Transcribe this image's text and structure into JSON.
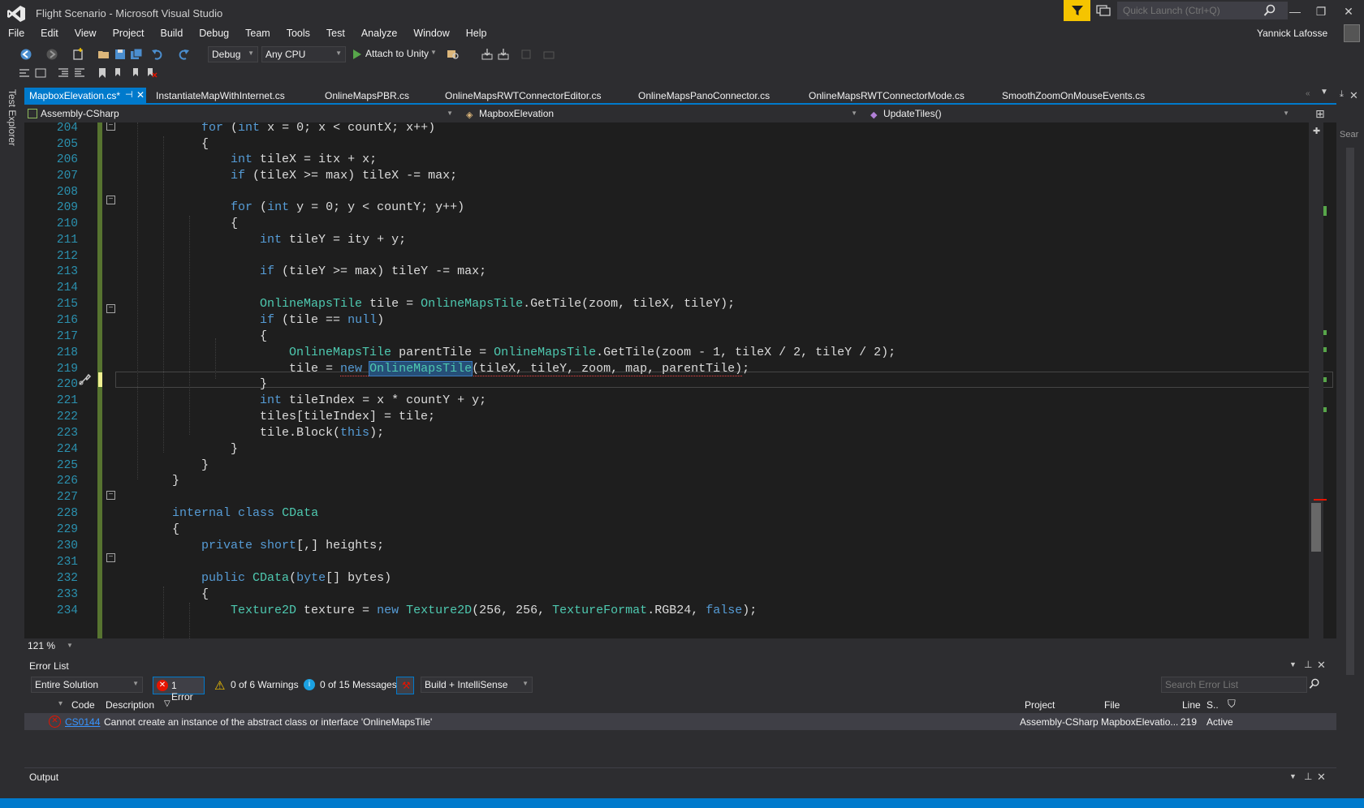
{
  "window": {
    "title": "Flight Scenario - Microsoft Visual Studio",
    "quick_launch_placeholder": "Quick Launch (Ctrl+Q)",
    "user": "Yannick Lafosse",
    "minimize": "—",
    "maximize": "❐",
    "close": "✕"
  },
  "menu": [
    "File",
    "Edit",
    "View",
    "Project",
    "Build",
    "Debug",
    "Team",
    "Tools",
    "Test",
    "Analyze",
    "Window",
    "Help"
  ],
  "toolbar": {
    "config": "Debug",
    "platform": "Any CPU",
    "attach": "Attach to Unity"
  },
  "side": {
    "left_tab": "Test Explorer",
    "right_tab": "Sear"
  },
  "tabs": [
    {
      "label": "MapboxElevation.cs*",
      "active": true
    },
    {
      "label": "InstantiateMapWithInternet.cs"
    },
    {
      "label": "OnlineMapsPBR.cs"
    },
    {
      "label": "OnlineMapsRWTConnectorEditor.cs"
    },
    {
      "label": "OnlineMapsPanoConnector.cs"
    },
    {
      "label": "OnlineMapsRWTConnectorMode.cs"
    },
    {
      "label": "SmoothZoomOnMouseEvents.cs"
    }
  ],
  "nav": {
    "project": "Assembly-CSharp",
    "class": "MapboxElevation",
    "member": "UpdateTiles()"
  },
  "editor": {
    "zoom": "121 %",
    "line_numbers": [
      "204",
      "205",
      "206",
      "207",
      "208",
      "209",
      "210",
      "211",
      "212",
      "213",
      "214",
      "215",
      "216",
      "217",
      "218",
      "219",
      "220",
      "221",
      "222",
      "223",
      "224",
      "225",
      "226",
      "227",
      "228",
      "229",
      "230",
      "231",
      "232",
      "233",
      "234"
    ]
  },
  "error_list": {
    "title": "Error List",
    "scope": "Entire Solution",
    "errors": "1 Error",
    "warnings": "0 of 6 Warnings",
    "messages": "0 of 15 Messages",
    "build_filter": "Build + IntelliSense",
    "search_placeholder": "Search Error List",
    "headers": {
      "code": "Code",
      "description": "Description",
      "project": "Project",
      "file": "File",
      "line": "Line",
      "suppression": "S.."
    },
    "rows": [
      {
        "code": "CS0144",
        "description": "Cannot create an instance of the abstract class or interface 'OnlineMapsTile'",
        "project": "Assembly-CSharp",
        "file": "MapboxElevatio...",
        "line": "219",
        "state": "Active"
      }
    ]
  },
  "output": {
    "title": "Output"
  },
  "colors": {
    "accent": "#007acc",
    "keyword": "#569cd6",
    "type": "#4ec9b0",
    "background": "#1e1e1e"
  }
}
